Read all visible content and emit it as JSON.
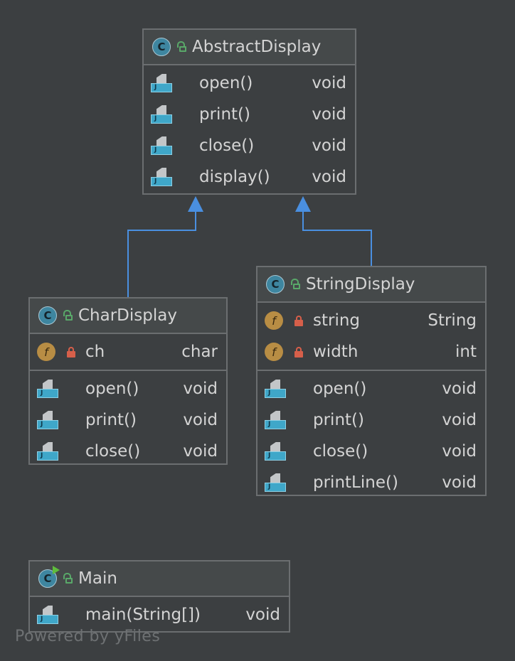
{
  "classes": {
    "abstract_display": {
      "name": "AbstractDisplay",
      "methods": [
        {
          "name": "open()",
          "type": "void"
        },
        {
          "name": "print()",
          "type": "void"
        },
        {
          "name": "close()",
          "type": "void"
        },
        {
          "name": "display()",
          "type": "void"
        }
      ]
    },
    "char_display": {
      "name": "CharDisplay",
      "fields": [
        {
          "name": "ch",
          "type": "char"
        }
      ],
      "methods": [
        {
          "name": "open()",
          "type": "void"
        },
        {
          "name": "print()",
          "type": "void"
        },
        {
          "name": "close()",
          "type": "void"
        }
      ]
    },
    "string_display": {
      "name": "StringDisplay",
      "fields": [
        {
          "name": "string",
          "type": "String"
        },
        {
          "name": "width",
          "type": "int"
        }
      ],
      "methods": [
        {
          "name": "open()",
          "type": "void"
        },
        {
          "name": "print()",
          "type": "void"
        },
        {
          "name": "close()",
          "type": "void"
        },
        {
          "name": "printLine()",
          "type": "void"
        }
      ]
    },
    "main": {
      "name": "Main",
      "methods": [
        {
          "name": "main(String[])",
          "type": "void"
        }
      ]
    }
  },
  "relations": [
    {
      "from": "CharDisplay",
      "to": "AbstractDisplay",
      "kind": "inheritance"
    },
    {
      "from": "StringDisplay",
      "to": "AbstractDisplay",
      "kind": "inheritance"
    }
  ],
  "watermark": "Powered by yFiles",
  "colors": {
    "background": "#3c3f41",
    "border": "#6b6e70",
    "arrow": "#4a8fe0",
    "class_icon": "#3e86a0",
    "field_icon": "#b88d44",
    "lock_private": "#d65f4a",
    "lock_public": "#59a869"
  }
}
